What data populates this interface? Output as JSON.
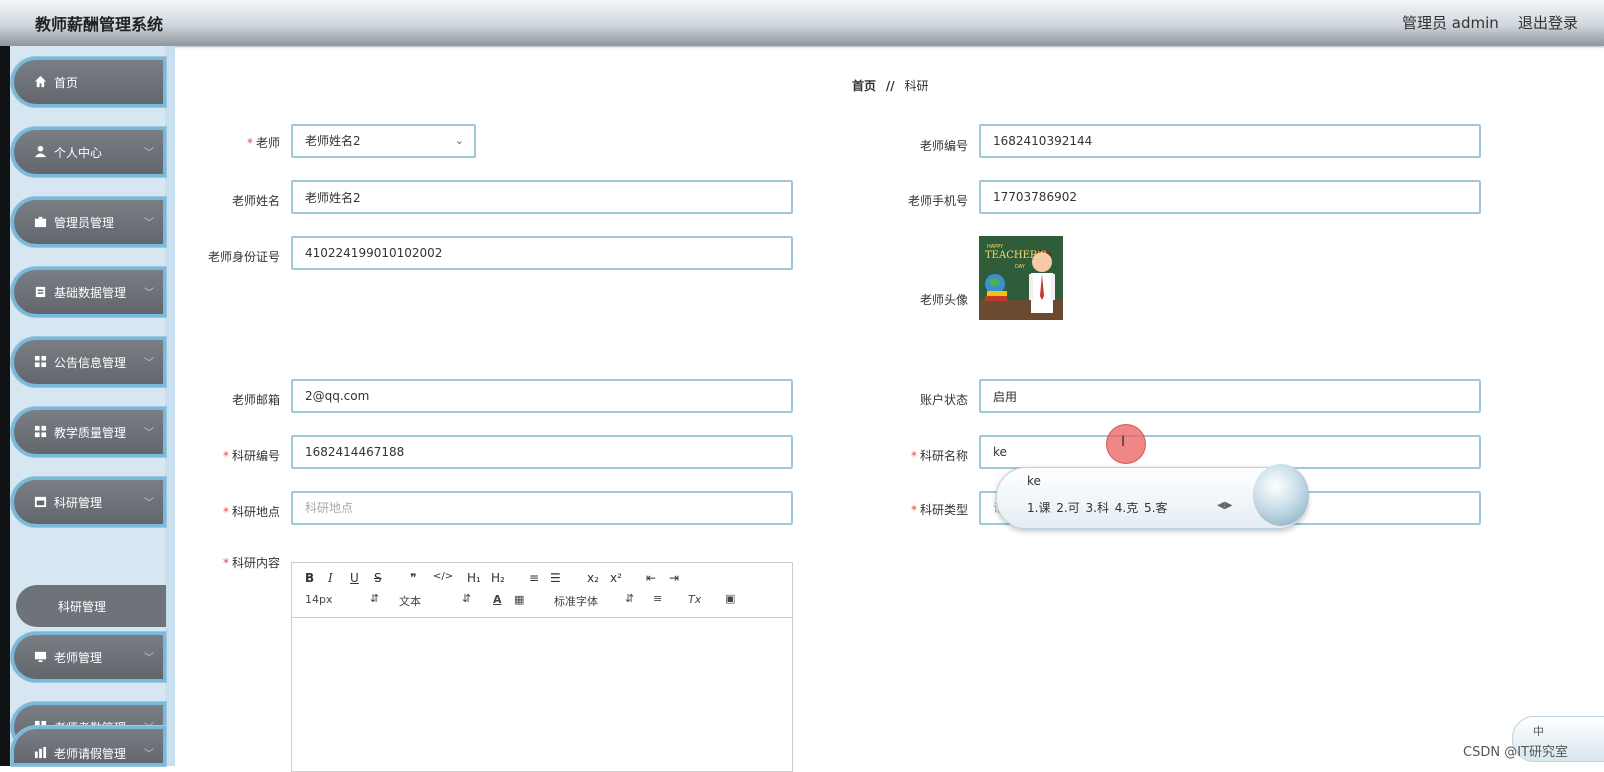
{
  "header": {
    "app_title": "教师薪酬管理系统",
    "admin_label": "管理员 admin",
    "logout": "退出登录"
  },
  "sidebar": {
    "items": [
      {
        "label": "首页",
        "icon": "home-icon",
        "has_chevron": false
      },
      {
        "label": "个人中心",
        "icon": "user-icon",
        "has_chevron": true
      },
      {
        "label": "管理员管理",
        "icon": "briefcase-icon",
        "has_chevron": true
      },
      {
        "label": "基础数据管理",
        "icon": "clipboard-icon",
        "has_chevron": true
      },
      {
        "label": "公告信息管理",
        "icon": "grid-icon",
        "has_chevron": true
      },
      {
        "label": "教学质量管理",
        "icon": "grid-icon",
        "has_chevron": true
      },
      {
        "label": "科研管理",
        "icon": "calendar-icon",
        "has_chevron": true
      },
      {
        "label": "老师管理",
        "icon": "monitor-icon",
        "has_chevron": true
      },
      {
        "label": "老师考勤管理",
        "icon": "grid-icon",
        "has_chevron": true
      },
      {
        "label": "老师请假管理",
        "icon": "chart-icon",
        "has_chevron": true
      }
    ],
    "sub_item": "科研管理"
  },
  "breadcrumb": {
    "home": "首页",
    "sep": "//",
    "current": "科研"
  },
  "form": {
    "teacher_label": "老师",
    "teacher_value": "老师姓名2",
    "teacher_no_label": "老师编号",
    "teacher_no_value": "1682410392144",
    "teacher_name_label": "老师姓名",
    "teacher_name_value": "老师姓名2",
    "teacher_phone_label": "老师手机号",
    "teacher_phone_value": "17703786902",
    "teacher_id_label": "老师身份证号",
    "teacher_id_value": "410224199010102002",
    "teacher_avatar_label": "老师头像",
    "teacher_email_label": "老师邮箱",
    "teacher_email_value": "2@qq.com",
    "account_status_label": "账户状态",
    "account_status_value": "启用",
    "research_no_label": "科研编号",
    "research_no_value": "1682414467188",
    "research_name_label": "科研名称",
    "research_name_value": "ke",
    "research_place_label": "科研地点",
    "research_place_placeholder": "科研地点",
    "research_type_label": "科研类型",
    "research_type_placeholder": "请",
    "research_content_label": "科研内容",
    "required_mark": "*"
  },
  "avatar": {
    "caption_small": "HAPPY",
    "caption_big": "TEACHER'S",
    "caption_day": "DAY"
  },
  "editor": {
    "row1": [
      "B",
      "I",
      "U",
      "S",
      "❞",
      "</>",
      "H₁",
      "H₂",
      "≡",
      "☰",
      "x₂",
      "x²",
      "⇤",
      "⇥"
    ],
    "font_size": "14px",
    "text_type": "文本",
    "font_family": "标准字体",
    "color_a": "A",
    "clear_format": "Tx"
  },
  "ime": {
    "input": "ke",
    "candidates": "1.课   2.可   3.科   4.克   5.客",
    "mini_label": "中"
  },
  "cursor_glyph": "I",
  "watermark": "CSDN @IT研究室"
}
